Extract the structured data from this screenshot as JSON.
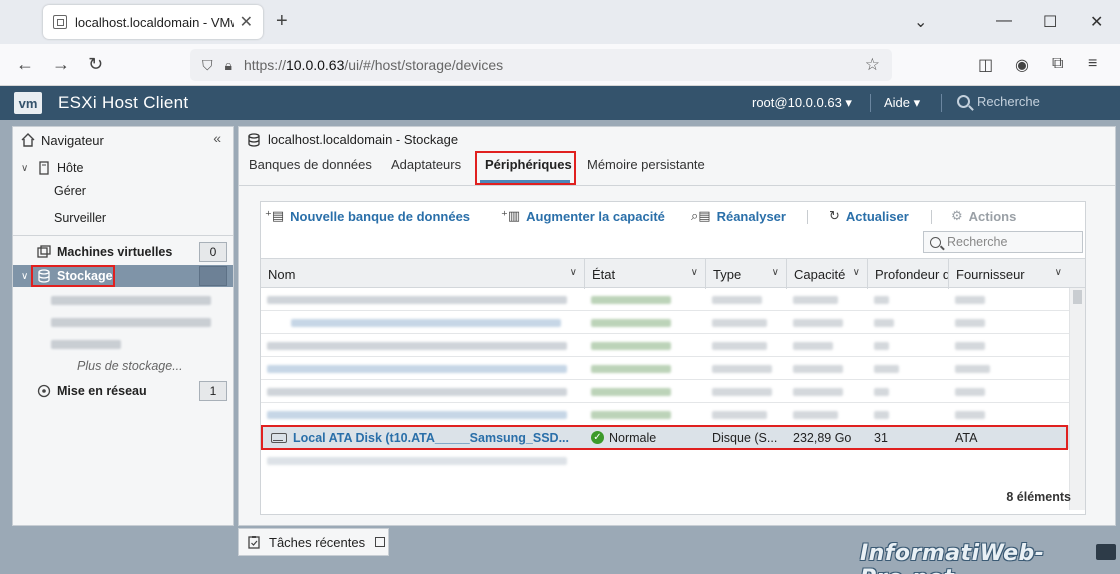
{
  "browser": {
    "tab_title": "localhost.localdomain - VMwar",
    "url_host": "10.0.0.63",
    "url_prefix": "https://",
    "url_path": "/ui/#/host/storage/devices"
  },
  "header": {
    "product": "ESXi Host Client",
    "logo": "vm",
    "user": "root@10.0.0.63 ▾",
    "help": "Aide ▾",
    "search_placeholder": "Recherche"
  },
  "navigator": {
    "title": "Navigateur",
    "host": "Hôte",
    "manage": "Gérer",
    "monitor": "Surveiller",
    "vms": "Machines virtuelles",
    "vms_count": "0",
    "storage": "Stockage",
    "more_storage": "Plus de stockage...",
    "network": "Mise en réseau",
    "network_count": "1"
  },
  "content": {
    "title": "localhost.localdomain - Stockage",
    "tabs": [
      "Banques de données",
      "Adaptateurs",
      "Périphériques",
      "Mémoire persistante"
    ],
    "toolbar": {
      "new_datastore": "Nouvelle banque de données",
      "increase_capacity": "Augmenter la capacité",
      "rescan": "Réanalyser",
      "refresh": "Actualiser",
      "actions": "Actions"
    },
    "search_placeholder": "Recherche",
    "columns": [
      "Nom",
      "État",
      "Type",
      "Capacité",
      "Profondeur d",
      "Fournisseur"
    ],
    "selected_row": {
      "name": "Local ATA Disk (t10.ATA_____Samsung_SSD...",
      "state": "Normale",
      "type": "Disque (S...",
      "capacity": "232,89 Go",
      "queue_depth": "31",
      "vendor": "ATA"
    },
    "items_count": "8 éléments"
  },
  "recent_tasks": "Tâches récentes",
  "watermark": "InformatiWeb-Pro.net",
  "colors": {
    "header_bg": "#34536c",
    "highlight_red": "#e0201f",
    "link_blue": "#2a6fa9",
    "status_green": "#3c9a2b"
  }
}
